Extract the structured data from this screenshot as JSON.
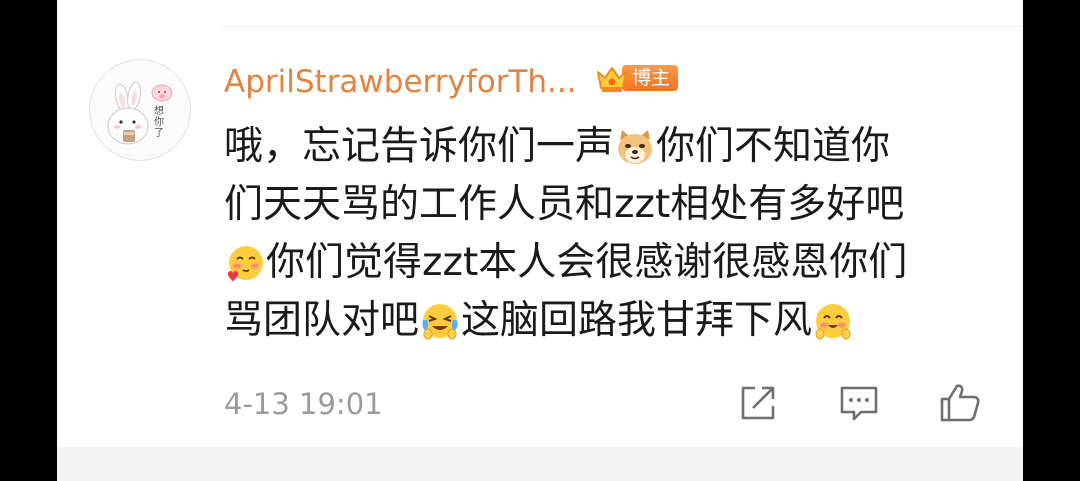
{
  "comment": {
    "username": "AprilStrawberryforTh...",
    "badge_label": "博主",
    "avatar_text": "想你了",
    "text_segments": [
      "哦，忘记告诉你们一声",
      "你们不知道你",
      "们天天骂的工作人员和zzt相处有多好吧",
      "你们觉得zzt本人会很感谢很感恩你们",
      "骂团队对吧",
      "这脑回路我甘拜下风"
    ],
    "emojis": [
      "doge-emoji",
      "shy-blush-emoji",
      "crying-laugh-emoji",
      "smile-blush-emoji"
    ],
    "timestamp": "4-13 19:01"
  },
  "actions": {
    "icons": [
      "share-icon",
      "comment-icon",
      "like-icon"
    ]
  },
  "colors": {
    "username": "#e4823f",
    "text": "#1a1a1a",
    "meta": "#9b9b9b",
    "badge": "#f4721f"
  }
}
